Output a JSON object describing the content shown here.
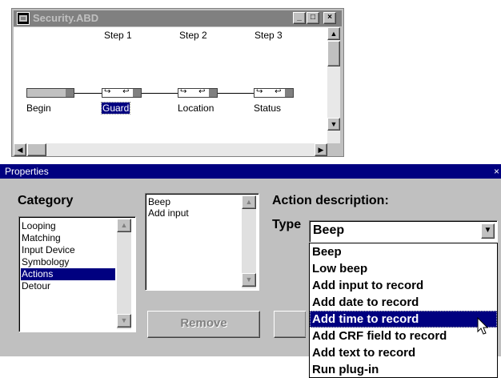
{
  "window": {
    "title": "Security.ABD",
    "controls": {
      "minimize": "_",
      "maximize": "□",
      "close": "×"
    },
    "steps": [
      "Step 1",
      "Step 2",
      "Step 3"
    ],
    "nodes": [
      {
        "label": "Begin"
      },
      {
        "label": "Guard",
        "selected": true
      },
      {
        "label": "Location"
      },
      {
        "label": "Status"
      }
    ],
    "node_port_glyphs": "↪ ↩"
  },
  "properties": {
    "title": "Properties",
    "close_glyph": "×",
    "category_heading": "Category",
    "categories": [
      "Looping",
      "Matching",
      "Input Device",
      "Symbology",
      "Actions",
      "Detour"
    ],
    "selected_category": "Actions",
    "actions": [
      "Beep",
      "Add input"
    ],
    "remove_label": "Remove",
    "action_description_label": "Action description:",
    "type_label": "Type",
    "type_value": "Beep",
    "type_options": [
      "Beep",
      "Low beep",
      "Add input to record",
      "Add date to record",
      "Add time to record",
      "Add CRF field to record",
      "Add text to record",
      "Run plug-in"
    ],
    "highlighted_option": "Add time to record"
  },
  "colors": {
    "face": "#c0c0c0",
    "selection": "#000080",
    "inactive_title": "#808080"
  }
}
